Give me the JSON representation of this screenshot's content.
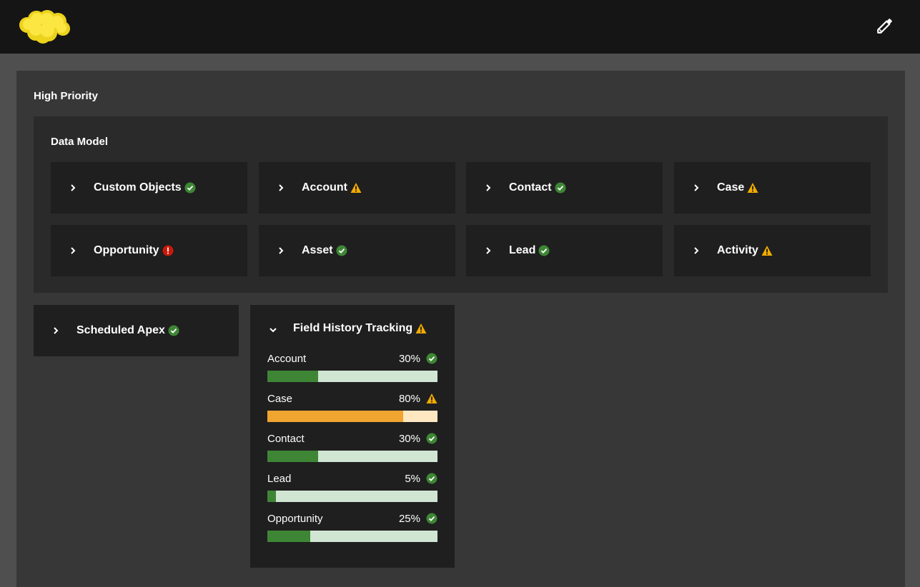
{
  "header": {
    "logo": "cloud-logo",
    "edit_icon": "pencil-icon"
  },
  "section": {
    "title": "High Priority",
    "data_model": {
      "title": "Data Model",
      "cards": [
        {
          "label": "Custom Objects",
          "status": "success"
        },
        {
          "label": "Account",
          "status": "warning"
        },
        {
          "label": "Contact",
          "status": "success"
        },
        {
          "label": "Case",
          "status": "warning"
        },
        {
          "label": "Opportunity",
          "status": "error"
        },
        {
          "label": "Asset",
          "status": "success"
        },
        {
          "label": "Lead",
          "status": "success"
        },
        {
          "label": "Activity",
          "status": "warning"
        }
      ]
    },
    "scheduled_apex": {
      "label": "Scheduled Apex",
      "status": "success"
    },
    "field_history": {
      "title": "Field History Tracking",
      "status": "warning",
      "expanded": true,
      "rows": [
        {
          "name": "Account",
          "percent": "30%",
          "value": 30,
          "status": "success"
        },
        {
          "name": "Case",
          "percent": "80%",
          "value": 80,
          "status": "warning"
        },
        {
          "name": "Contact",
          "percent": "30%",
          "value": 30,
          "status": "success"
        },
        {
          "name": "Lead",
          "percent": "5%",
          "value": 5,
          "status": "success"
        },
        {
          "name": "Opportunity",
          "percent": "25%",
          "value": 25,
          "status": "success"
        }
      ]
    }
  },
  "colors": {
    "success": "#3e8635",
    "success_track": "#d1e5d3",
    "warning": "#f0ab00",
    "warning_bar": "#efa52f",
    "warning_track": "#fde8c2",
    "error": "#c9190b"
  }
}
